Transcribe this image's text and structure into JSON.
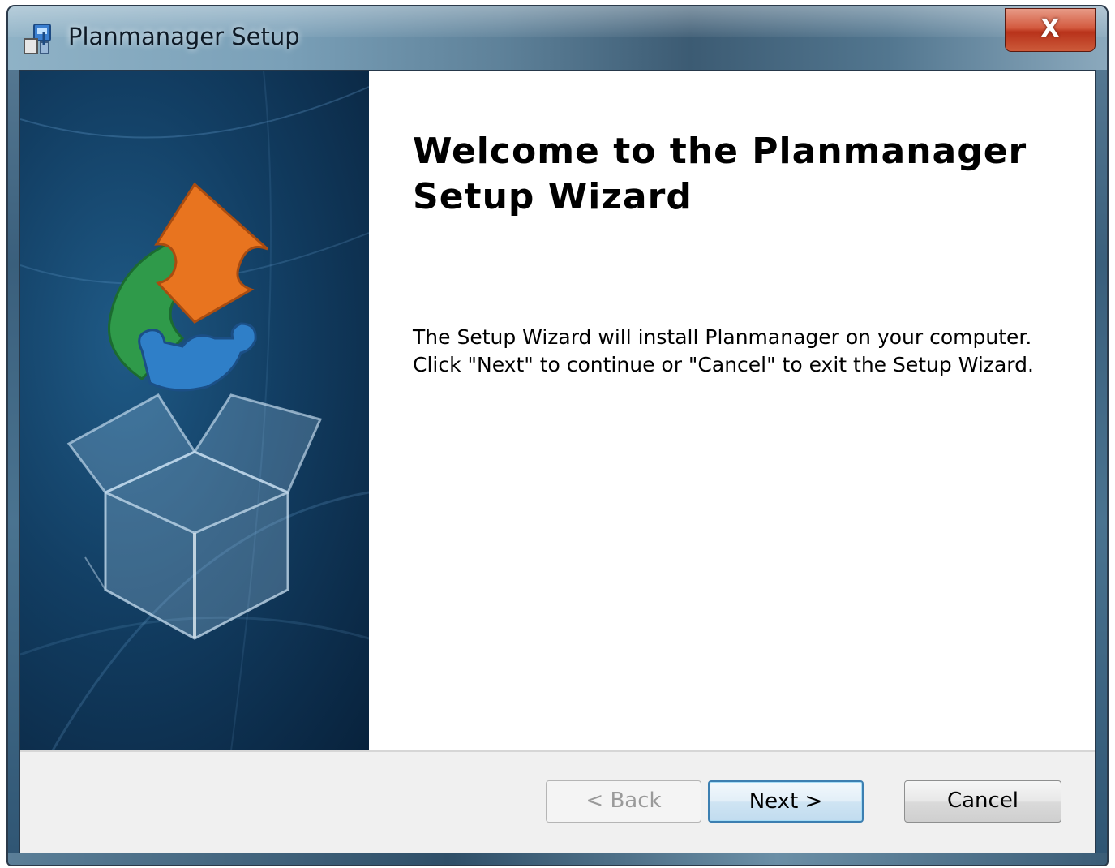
{
  "window": {
    "title": "Planmanager Setup",
    "close_label": "X"
  },
  "banner": {
    "image": "setup-box-with-puzzle-graphic"
  },
  "content": {
    "heading_line1": "Welcome to the Planmanager",
    "heading_line2": "Setup Wizard",
    "body_line1": "The Setup Wizard will install Planmanager on your computer.",
    "body_line2": "Click \"Next\" to continue or \"Cancel\" to exit the Setup Wizard."
  },
  "buttons": {
    "back": "< Back",
    "next": "Next >",
    "cancel": "Cancel"
  },
  "colors": {
    "banner_bg": "#123e63",
    "puzzle_orange": "#e8741f",
    "puzzle_green": "#2f9a4a",
    "puzzle_blue": "#2f7fc8",
    "close_red": "#c2401f"
  }
}
